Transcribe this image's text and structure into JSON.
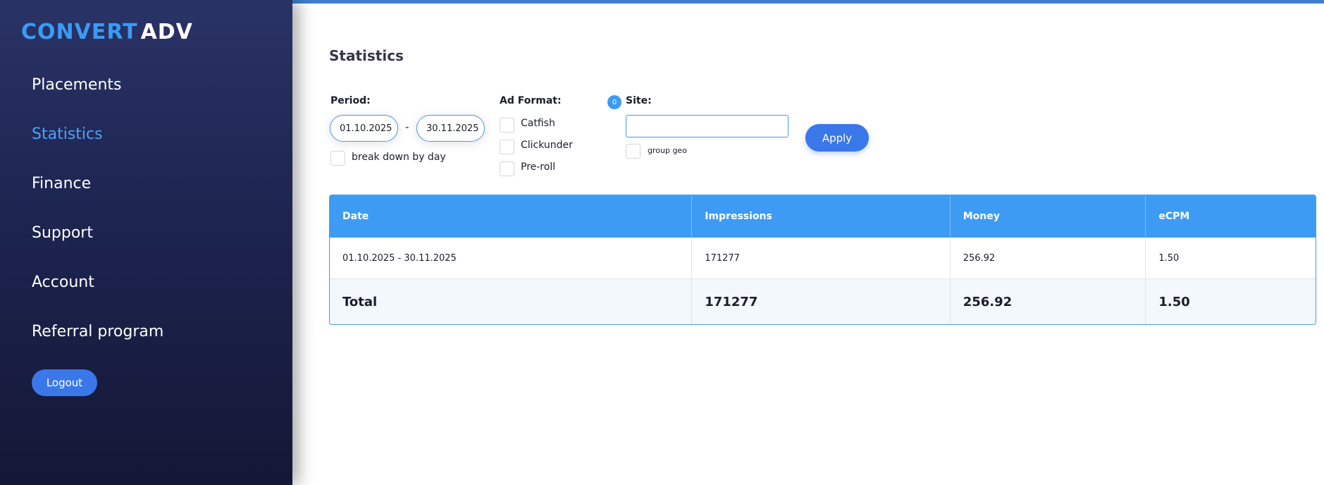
{
  "logo": {
    "part1": "CONVERT",
    "part2": "ADV"
  },
  "nav": {
    "placements": "Placements",
    "statistics": "Statistics",
    "finance": "Finance",
    "support": "Support",
    "account": "Account",
    "referral": "Referral program"
  },
  "logout_label": "Logout",
  "page_title": "Statistics",
  "filters": {
    "period_label": "Period:",
    "date_from": "01.10.2025",
    "date_separator": "-",
    "date_to": "30.11.2025",
    "break_down_label": "break down by day",
    "ad_format_label": "Ad Format:",
    "formats": [
      "Catfish",
      "Clickunder",
      "Pre-roll"
    ],
    "site_badge": "0",
    "site_label": "Site:",
    "site_value": "",
    "group_geo_label": "group geo",
    "apply_label": "Apply"
  },
  "table": {
    "headers": [
      "Date",
      "Impressions",
      "Money",
      "eCPM"
    ],
    "rows": [
      [
        "01.10.2025 - 30.11.2025",
        "171277",
        "256.92",
        "1.50"
      ]
    ],
    "total": [
      "Total",
      "171277",
      "256.92",
      "1.50"
    ]
  },
  "colors": {
    "accent": "#3d9bf3",
    "button": "#3a78ea",
    "sidebar": "#1d2450"
  }
}
